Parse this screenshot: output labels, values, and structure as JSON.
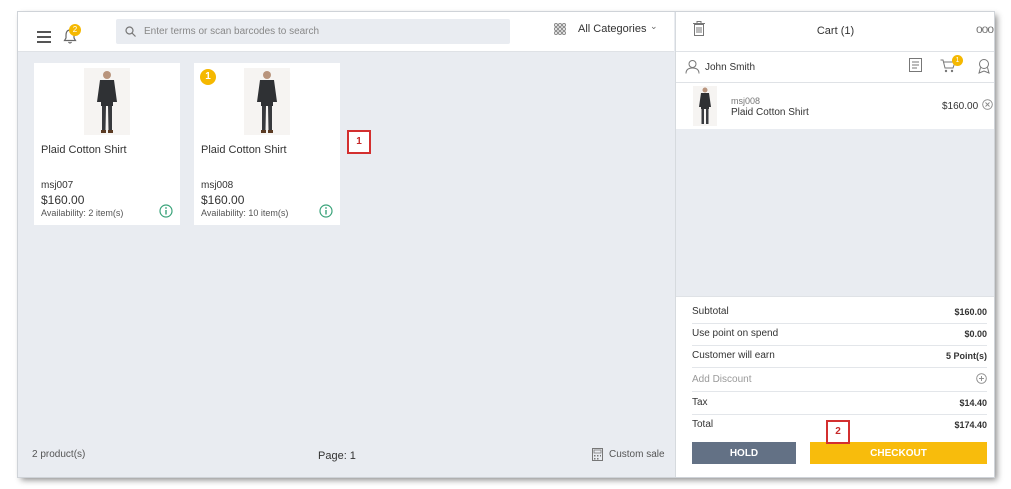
{
  "header": {
    "notification_count": "2",
    "search_placeholder": "Enter terms or scan barcodes to search",
    "category_label": "All Categories"
  },
  "products": [
    {
      "name": "Plaid Cotton Shirt",
      "sku": "msj007",
      "price": "$160.00",
      "availability": "Availability: 2 item(s)",
      "qty_in_cart": ""
    },
    {
      "name": "Plaid Cotton Shirt",
      "sku": "msj008",
      "price": "$160.00",
      "availability": "Availability: 10 item(s)",
      "qty_in_cart": "1"
    }
  ],
  "callouts": {
    "one": "1",
    "two": "2"
  },
  "footer": {
    "product_count": "2 product(s)",
    "page": "Page: 1",
    "custom_sale": "Custom sale"
  },
  "cart": {
    "title": "Cart (1)",
    "customer": "John Smith",
    "cart_badge": "1",
    "items": [
      {
        "sku": "msj008",
        "name": "Plaid Cotton Shirt",
        "price": "$160.00"
      }
    ],
    "summary": {
      "subtotal_label": "Subtotal",
      "subtotal": "$160.00",
      "points_label": "Use point on spend",
      "points": "$0.00",
      "earn_label": "Customer will earn",
      "earn": "5 Point(s)",
      "discount_label": "Add Discount",
      "tax_label": "Tax",
      "tax": "$14.40",
      "total_label": "Total",
      "total": "$174.40"
    },
    "hold_label": "HOLD",
    "checkout_label": "CHECKOUT"
  },
  "colors": {
    "accent": "#f8bc0c",
    "hold": "#637185",
    "callout": "#d32f2f"
  },
  "icons": [
    "menu-icon",
    "bell-icon",
    "search-icon",
    "grid-icon",
    "chevron-down-icon",
    "trash-icon",
    "more-icon",
    "user-icon",
    "receipt-icon",
    "cart-icon",
    "loyalty-icon",
    "info-icon",
    "remove-icon",
    "plus-circle-icon",
    "calculator-icon"
  ]
}
